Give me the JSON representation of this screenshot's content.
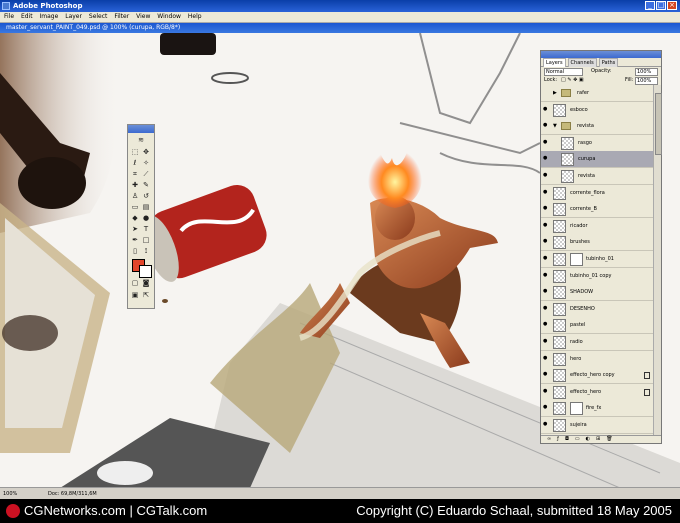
{
  "app": {
    "title": "Adobe Photoshop"
  },
  "menu": [
    "File",
    "Edit",
    "Image",
    "Layer",
    "Select",
    "Filter",
    "View",
    "Window",
    "Help"
  ],
  "document": {
    "title": "master_servant_PAINT_049.psd @ 100% (curupa, RGB/8*)"
  },
  "status": {
    "zoom": "100%",
    "doc": "Doc: 69,8M/311,6M"
  },
  "caption": {
    "left": "CGNetworks.com | CGTalk.com",
    "right": "Copyright (C) Eduardo Schaal, submitted 18 May 2005"
  },
  "layers_panel": {
    "tabs": [
      "Layers",
      "Channels",
      "Paths"
    ],
    "blend_mode": "Normal",
    "opacity_label": "Opacity:",
    "opacity": "100%",
    "lock_label": "Lock:",
    "fill_label": "Fill:",
    "fill": "100%",
    "layers": [
      {
        "name": "rafer",
        "kind": "folder",
        "collapsed": true
      },
      {
        "name": "esboco",
        "kind": "layer"
      },
      {
        "name": "revista",
        "kind": "folder",
        "collapsed": false
      },
      {
        "name": "rasgo",
        "kind": "layer",
        "indent": true
      },
      {
        "name": "curupa",
        "kind": "layer",
        "indent": true,
        "selected": true
      },
      {
        "name": "revista",
        "kind": "layer",
        "indent": true
      },
      {
        "name": "corrente_flora",
        "kind": "layer"
      },
      {
        "name": "corrente_B",
        "kind": "layer"
      },
      {
        "name": "ricador",
        "kind": "layer"
      },
      {
        "name": "brushes",
        "kind": "layer"
      },
      {
        "name": "tubinho_01",
        "kind": "masked"
      },
      {
        "name": "tubinho_01 copy",
        "kind": "layer"
      },
      {
        "name": "SHADOW",
        "kind": "layer"
      },
      {
        "name": "DESENHO",
        "kind": "layer"
      },
      {
        "name": "pastel",
        "kind": "layer"
      },
      {
        "name": "radio",
        "kind": "layer"
      },
      {
        "name": "hero",
        "kind": "layer"
      },
      {
        "name": "effecto_hero copy",
        "kind": "layer",
        "locked": true
      },
      {
        "name": "effecto_hero",
        "kind": "layer",
        "locked": true
      },
      {
        "name": "fire_fx",
        "kind": "masked"
      },
      {
        "name": "sujeira",
        "kind": "layer"
      }
    ]
  },
  "toolbox": {
    "tools": [
      "move-tool",
      "marquee-tool",
      "lasso-tool",
      "magic-wand-tool",
      "crop-tool",
      "slice-tool",
      "healing-brush-tool",
      "brush-tool",
      "clone-stamp-tool",
      "history-brush-tool",
      "eraser-tool",
      "gradient-tool",
      "blur-tool",
      "dodge-tool",
      "path-selection-tool",
      "type-tool",
      "pen-tool",
      "shape-tool",
      "notes-tool",
      "eyedropper-tool",
      "hand-tool",
      "zoom-tool"
    ],
    "foreground_color": "#e2452b",
    "background_color": "#ffffff"
  },
  "colors": {
    "titlebar": "#0a3fa8",
    "selected_layer": "#a9a9b3",
    "panel_bg": "#ece9d8"
  }
}
